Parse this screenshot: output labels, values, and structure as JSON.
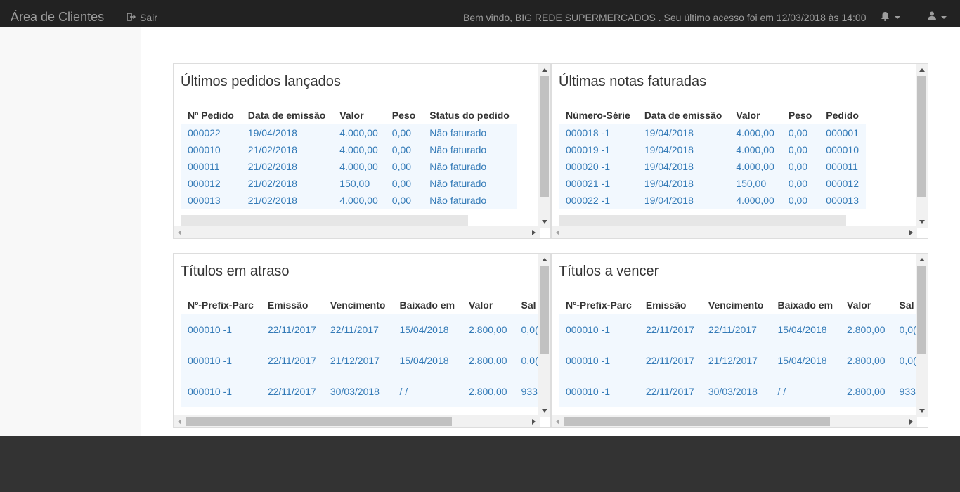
{
  "navbar": {
    "brand": "Área de Clientes",
    "logout_label": "Sair",
    "welcome": "Bem vindo, BIG REDE SUPERMERCADOS . Seu último acesso foi em 12/03/2018 às 14:00"
  },
  "panels": {
    "pedidos": {
      "title": "Últimos pedidos lançados",
      "headers": [
        "Nº Pedido",
        "Data de emissão",
        "Valor",
        "Peso",
        "Status do pedido"
      ],
      "rows": [
        [
          "000022",
          "19/04/2018",
          "4.000,00",
          "0,00",
          "Não faturado"
        ],
        [
          "000010",
          "21/02/2018",
          "4.000,00",
          "0,00",
          "Não faturado"
        ],
        [
          "000011",
          "21/02/2018",
          "4.000,00",
          "0,00",
          "Não faturado"
        ],
        [
          "000012",
          "21/02/2018",
          "150,00",
          "0,00",
          "Não faturado"
        ],
        [
          "000013",
          "21/02/2018",
          "4.000,00",
          "0,00",
          "Não faturado"
        ]
      ]
    },
    "notas": {
      "title": "Últimas notas faturadas",
      "headers": [
        "Número-Série",
        "Data de emissão",
        "Valor",
        "Peso",
        "Pedido"
      ],
      "rows": [
        [
          "000018 -1",
          "19/04/2018",
          "4.000,00",
          "0,00",
          "000001"
        ],
        [
          "000019 -1",
          "19/04/2018",
          "4.000,00",
          "0,00",
          "000010"
        ],
        [
          "000020 -1",
          "19/04/2018",
          "4.000,00",
          "0,00",
          "000011"
        ],
        [
          "000021 -1",
          "19/04/2018",
          "150,00",
          "0,00",
          "000012"
        ],
        [
          "000022 -1",
          "19/04/2018",
          "4.000,00",
          "0,00",
          "000013"
        ]
      ]
    },
    "atraso": {
      "title": "Títulos em atraso",
      "headers": [
        "Nº-Prefix-Parc",
        "Emissão",
        "Vencimento",
        "Baixado em",
        "Valor",
        "Sal"
      ],
      "rows": [
        [
          "000010 -1",
          "22/11/2017",
          "22/11/2017",
          "15/04/2018",
          "2.800,00",
          "0,0("
        ],
        [
          "000010 -1",
          "22/11/2017",
          "21/12/2017",
          "15/04/2018",
          "2.800,00",
          "0,0("
        ],
        [
          "000010 -1",
          "22/11/2017",
          "30/03/2018",
          "/ /",
          "2.800,00",
          "933"
        ]
      ]
    },
    "vencer": {
      "title": "Títulos a vencer",
      "headers": [
        "Nº-Prefix-Parc",
        "Emissão",
        "Vencimento",
        "Baixado em",
        "Valor",
        "Sal"
      ],
      "rows": [
        [
          "000010 -1",
          "22/11/2017",
          "22/11/2017",
          "15/04/2018",
          "2.800,00",
          "0,0("
        ],
        [
          "000010 -1",
          "22/11/2017",
          "21/12/2017",
          "15/04/2018",
          "2.800,00",
          "0,0("
        ],
        [
          "000010 -1",
          "22/11/2017",
          "30/03/2018",
          "/ /",
          "2.800,00",
          "933"
        ]
      ]
    }
  },
  "icons": {
    "logout": "sign-out-icon",
    "notifications": "bell-icon",
    "user": "user-icon"
  }
}
